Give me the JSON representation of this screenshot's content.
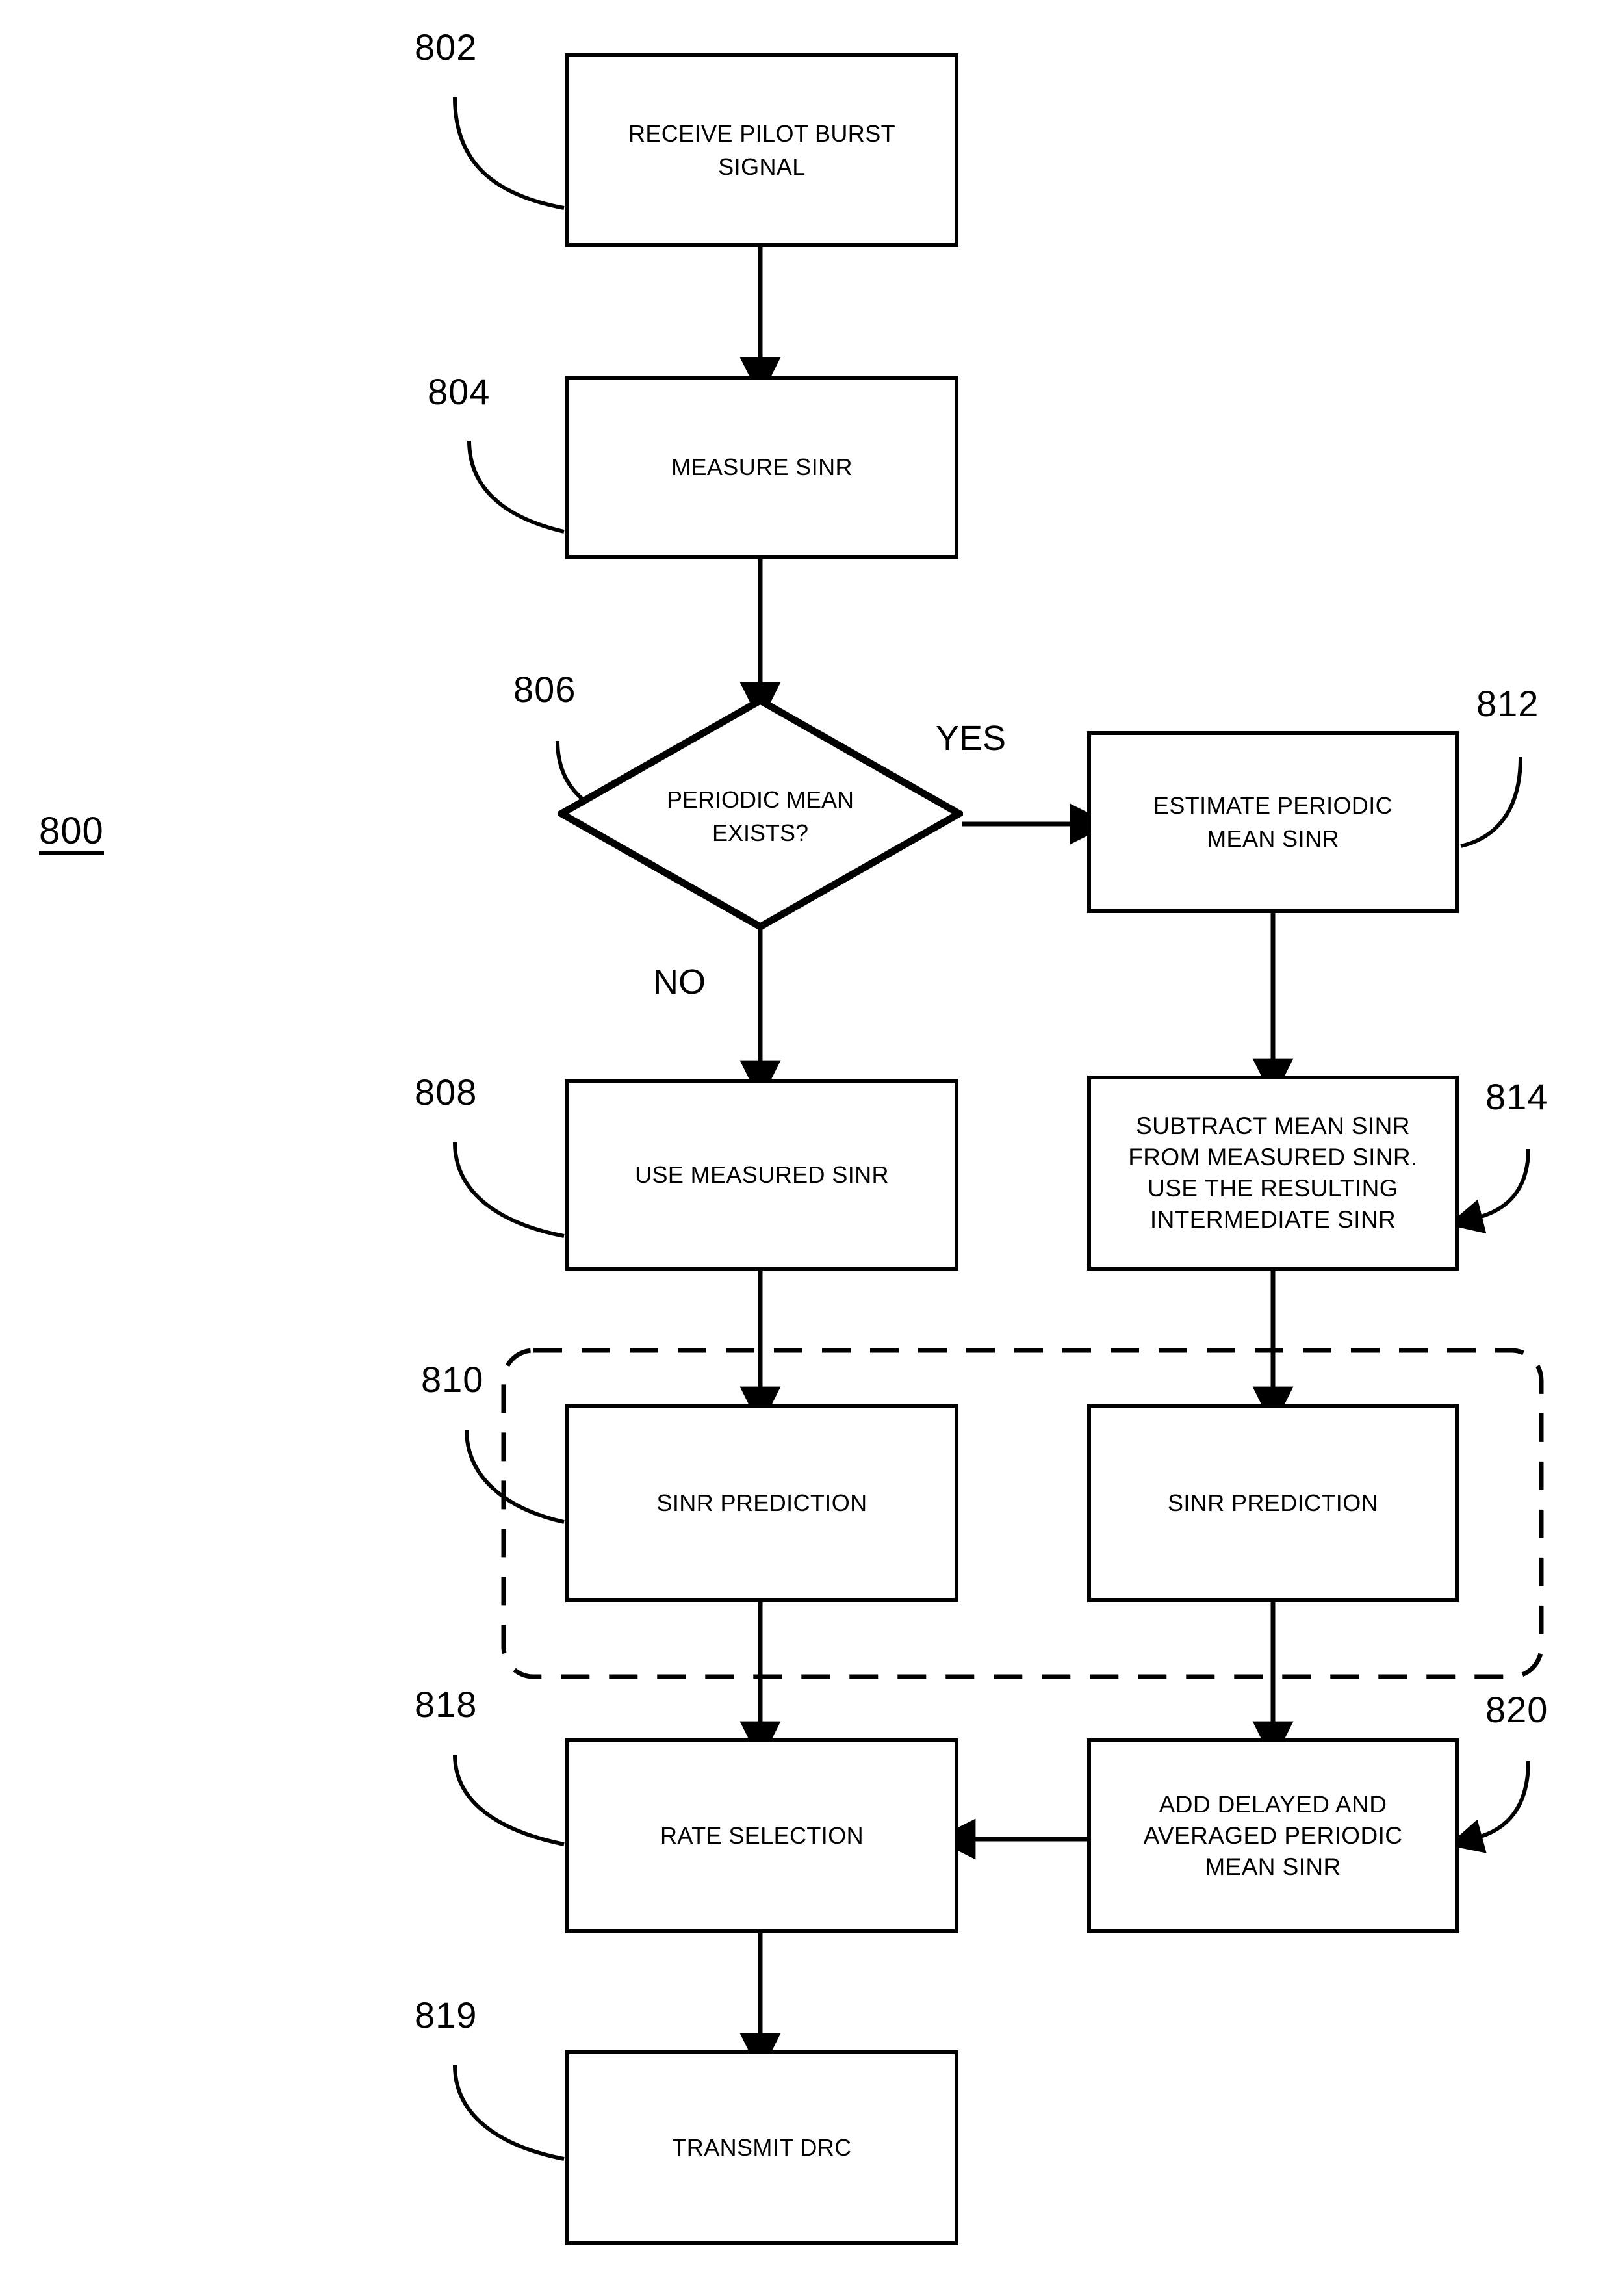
{
  "figure": {
    "number": "800",
    "type": "patent-flowchart"
  },
  "branch_labels": {
    "yes": "YES",
    "no": "NO"
  },
  "nodes": [
    {
      "ref": "802",
      "shape": "process",
      "text": "RECEIVE PILOT BURST\nSIGNAL"
    },
    {
      "ref": "804",
      "shape": "process",
      "text": "MEASURE SINR"
    },
    {
      "ref": "806",
      "shape": "decision",
      "text": "PERIODIC MEAN\nEXISTS?"
    },
    {
      "ref": "812",
      "shape": "process",
      "text": "ESTIMATE PERIODIC\nMEAN SINR"
    },
    {
      "ref": "808",
      "shape": "process",
      "text": "USE MEASURED SINR"
    },
    {
      "ref": "814",
      "shape": "process",
      "text": "SUBTRACT MEAN SINR\nFROM MEASURED SINR.\nUSE THE RESULTING\nINTERMEDIATE SINR"
    },
    {
      "ref": "810",
      "shape": "process",
      "text": "SINR PREDICTION"
    },
    {
      "ref": "810b",
      "shape": "process",
      "text": "SINR PREDICTION"
    },
    {
      "ref": "818",
      "shape": "process",
      "text": "RATE SELECTION"
    },
    {
      "ref": "820",
      "shape": "process",
      "text": "ADD DELAYED AND\nAVERAGED PERIODIC\nMEAN SINR"
    },
    {
      "ref": "819",
      "shape": "process",
      "text": "TRANSMIT DRC"
    }
  ],
  "refs": {
    "r802": "802",
    "r804": "804",
    "r806": "806",
    "r808": "808",
    "r810": "810",
    "r812": "812",
    "r814": "814",
    "r818": "818",
    "r819": "819",
    "r820": "820",
    "r800": "800"
  },
  "colors": {
    "stroke": "#000000",
    "background": "#ffffff"
  }
}
